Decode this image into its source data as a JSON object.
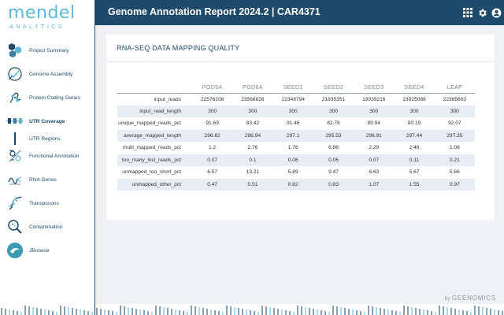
{
  "brand": {
    "name": "mendel",
    "tagline": "ANALYTICS"
  },
  "header": {
    "title": "Genome Annotation Report 2024.2 | CAR4371"
  },
  "header_icons": [
    "grid-icon",
    "gear-icon",
    "user-icon"
  ],
  "nav": [
    {
      "label": "Project Summary",
      "icon": "hexagon-cluster-icon"
    },
    {
      "label": "Genome Assembly",
      "icon": "dna-check-icon"
    },
    {
      "label": "Protein Coding Genes",
      "icon": "protein-icon"
    },
    {
      "label": "UTR Coverage",
      "icon": "utr-icon",
      "active": true
    },
    {
      "label": "UTR Regions",
      "icon": "utr-regions-icon"
    },
    {
      "label": "Functional Annotation",
      "icon": "functional-icon"
    },
    {
      "label": "RNA Genes",
      "icon": "rna-icon"
    },
    {
      "label": "Transposons",
      "icon": "transposon-icon"
    },
    {
      "label": "Contamination",
      "icon": "magnifier-icon"
    },
    {
      "label": "JBrowse",
      "icon": "jbrowse-icon"
    }
  ],
  "card": {
    "title": "RNA-SEQ DATA MAPPING QUALITY"
  },
  "table": {
    "columns": [
      "POD5A",
      "POD6A",
      "SEED1",
      "SEED2",
      "SEED3",
      "SEED4",
      "LEAF"
    ],
    "rows": [
      {
        "label": "input_reads",
        "values": [
          "22576206",
          "23568826",
          "22348794",
          "21835351",
          "19939216",
          "23925088",
          "22385803"
        ]
      },
      {
        "label": "input_read_length",
        "values": [
          "300",
          "300",
          "300",
          "300",
          "300",
          "300",
          "300"
        ]
      },
      {
        "label": "unique_mapped_reads_pct",
        "values": [
          "91.69",
          "83.42",
          "91.46",
          "82.78",
          "89.94",
          "90.19",
          "92.07"
        ]
      },
      {
        "label": "average_mapped_length",
        "values": [
          "296.82",
          "286.94",
          "297.1",
          "295.53",
          "296.91",
          "297.44",
          "297.35"
        ]
      },
      {
        "label": "multi_mapped_reads_pct",
        "values": [
          "1.2",
          "2.76",
          "1.76",
          "6.86",
          "2.29",
          "2.48",
          "1.08"
        ]
      },
      {
        "label": "too_many_loci_reads_pct",
        "values": [
          "0.07",
          "0.1",
          "0.08",
          "0.06",
          "0.07",
          "0.11",
          "0.21"
        ]
      },
      {
        "label": "unmapped_too_short_pct",
        "values": [
          "6.57",
          "13.21",
          "5.89",
          "9.47",
          "6.63",
          "5.67",
          "5.66"
        ]
      },
      {
        "label": "unmapped_other_pct",
        "values": [
          "0.47",
          "0.51",
          "0.82",
          "0.83",
          "1.07",
          "1.55",
          "0.97"
        ]
      }
    ]
  },
  "footer": {
    "by": "by",
    "company": "GEENOMICS"
  },
  "colors": {
    "primary": "#1e4a6b",
    "accent": "#5cb8d6",
    "row_alt": "#e7edf2",
    "background": "#eef2f5"
  }
}
